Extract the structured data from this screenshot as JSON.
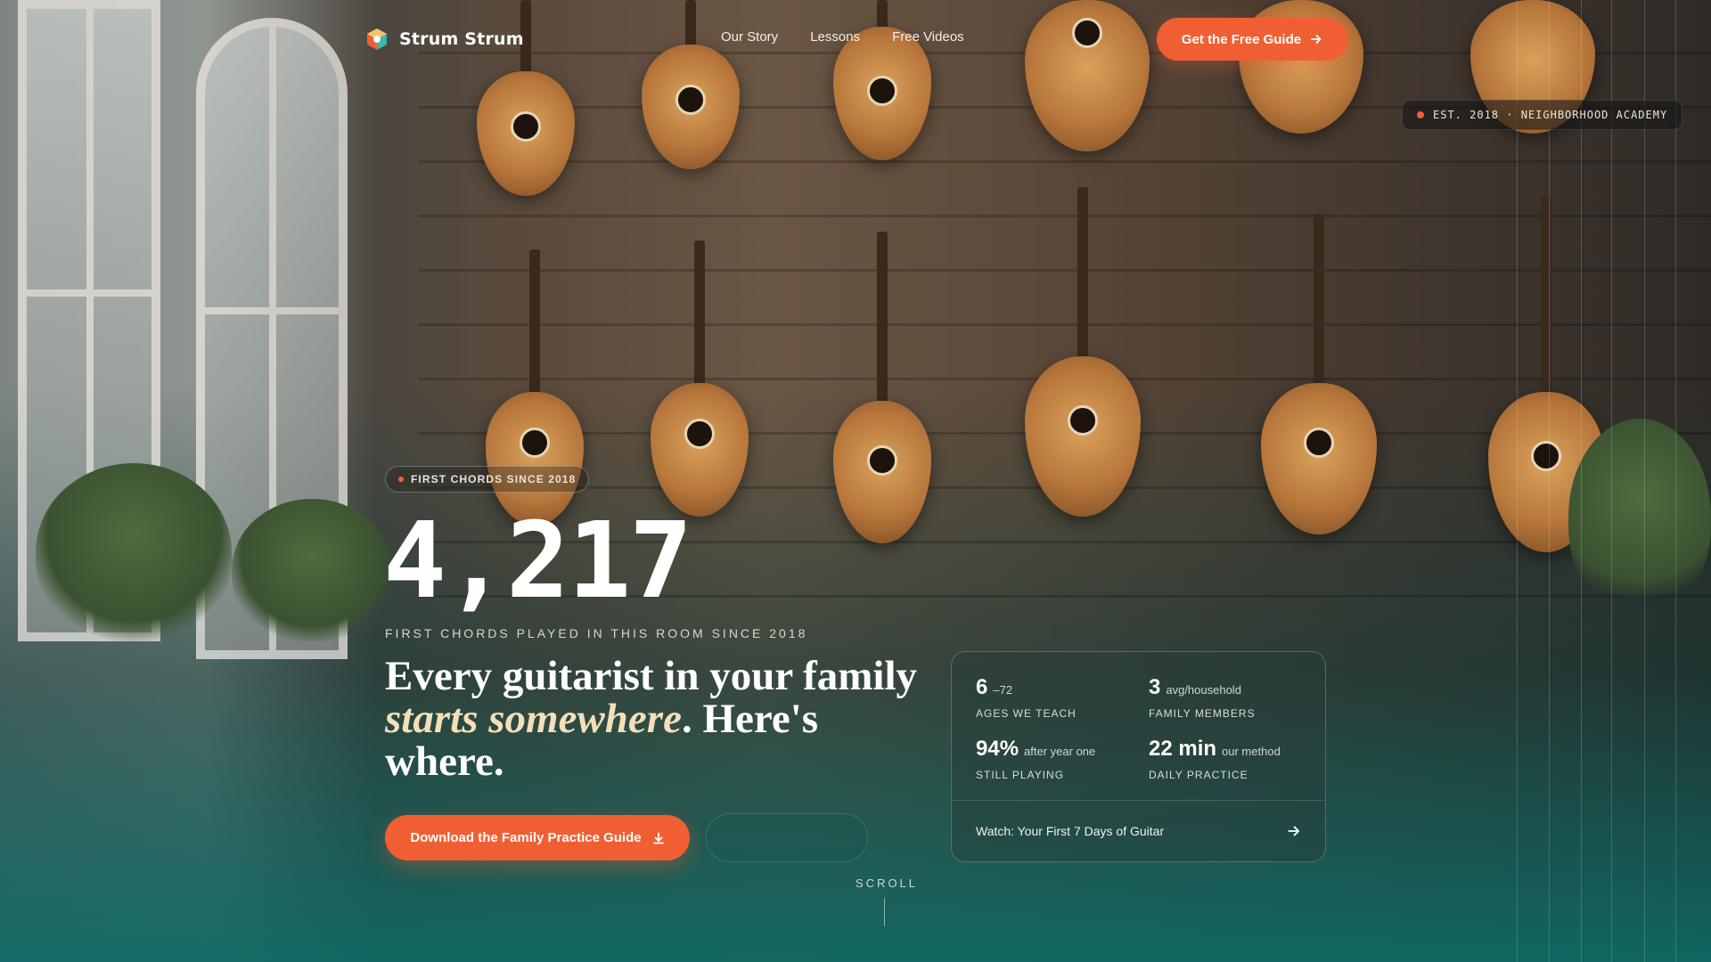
{
  "brand": {
    "name": "Strum Strum"
  },
  "nav": {
    "links": [
      "Our Story",
      "Lessons",
      "Free Videos"
    ],
    "cta_label": "Get the Free Guide"
  },
  "badge": {
    "text": "EST. 2018 · NEIGHBORHOOD ACADEMY"
  },
  "hero": {
    "eyebrow": "FIRST CHORDS SINCE 2018",
    "big_number": "4,217",
    "number_caption": "FIRST CHORDS PLAYED IN THIS ROOM SINCE 2018",
    "headline_part1": "Every guitarist in your family ",
    "headline_emphasis": "starts somewhere",
    "headline_part2": ". Here's where.",
    "primary_cta": "Download the Family Practice Guide",
    "scroll_label": "SCROLL"
  },
  "stats": [
    {
      "value": "6",
      "sub": "–72",
      "label": "AGES WE TEACH"
    },
    {
      "value": "3",
      "sub": "avg/household",
      "label": "FAMILY MEMBERS"
    },
    {
      "value": "94%",
      "sub": "after year one",
      "label": "STILL PLAYING"
    },
    {
      "value": "22 min",
      "sub": "our method",
      "label": "DAILY PRACTICE"
    }
  ],
  "watch": {
    "label": "Watch: Your First 7 Days of Guitar"
  },
  "colors": {
    "accent": "#f05f33",
    "teal": "#0e6964",
    "cream": "#f4dfb8"
  }
}
